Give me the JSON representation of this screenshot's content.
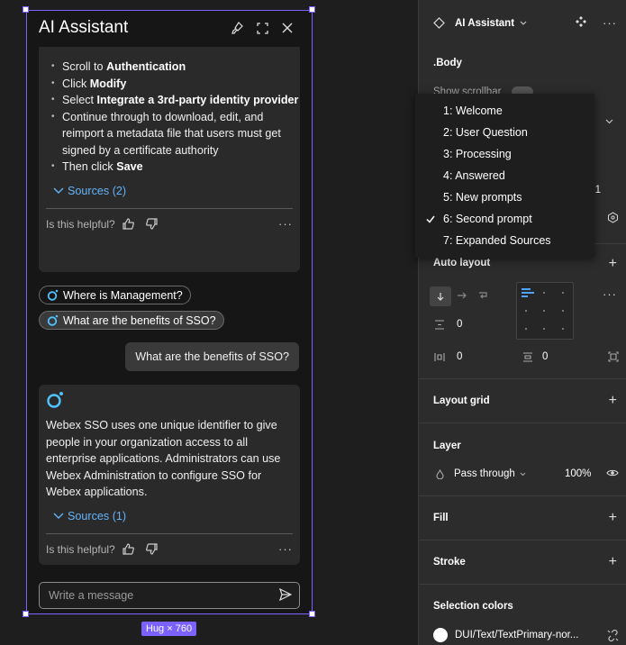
{
  "assistant": {
    "title": "AI Assistant",
    "hug_label": "Hug × 760",
    "steps": [
      {
        "pre": "Scroll to ",
        "bold": "Authentication",
        "post": ""
      },
      {
        "pre": "Click ",
        "bold": "Modify",
        "post": ""
      },
      {
        "pre": "Select ",
        "bold": "Integrate a 3rd-party identity provider",
        "post": ""
      },
      {
        "pre": "Continue through to download, edit, and reimport a metadata file that users must get signed by a certificate authority",
        "bold": "",
        "post": ""
      },
      {
        "pre": "Then click ",
        "bold": "Save",
        "post": ""
      }
    ],
    "sources1": "Sources (2)",
    "helpful": "Is this helpful?",
    "more": "···",
    "suggestions": [
      "Where is Management?",
      "What are the benefits of SSO?"
    ],
    "user_question": "What are the benefits of SSO?",
    "answer": "Webex SSO uses one unique identifier to give people in your organization access to all enterprise applications. Administrators can use Webex Administration to configure SSO for Webex applications.",
    "sources2": "Sources (1)",
    "composer_placeholder": "Write a message"
  },
  "panel": {
    "component_name": "AI Assistant",
    "body_label": ".Body",
    "show_scrollbar": "Show scrollbar",
    "partial_number": "e 1",
    "auto_layout": "Auto layout",
    "spacing_value": "0",
    "padding_h": "0",
    "padding_v": "0",
    "layout_grid": "Layout grid",
    "layer": "Layer",
    "blend_mode": "Pass through",
    "opacity": "100%",
    "fill": "Fill",
    "stroke": "Stroke",
    "selection_colors": "Selection colors",
    "color_token": "DUI/Text/TextPrimary-nor..."
  },
  "dropdown": {
    "items": [
      "1: Welcome",
      "2: User Question",
      "3: Processing",
      "4: Answered",
      "5: New prompts",
      "6: Second prompt",
      "7: Expanded Sources"
    ],
    "selected_index": 5
  },
  "colors": {
    "accent": "#7b61ff",
    "link": "#64b4fa",
    "canvas": "#1e1e1e",
    "panel": "#2c2c2c"
  }
}
